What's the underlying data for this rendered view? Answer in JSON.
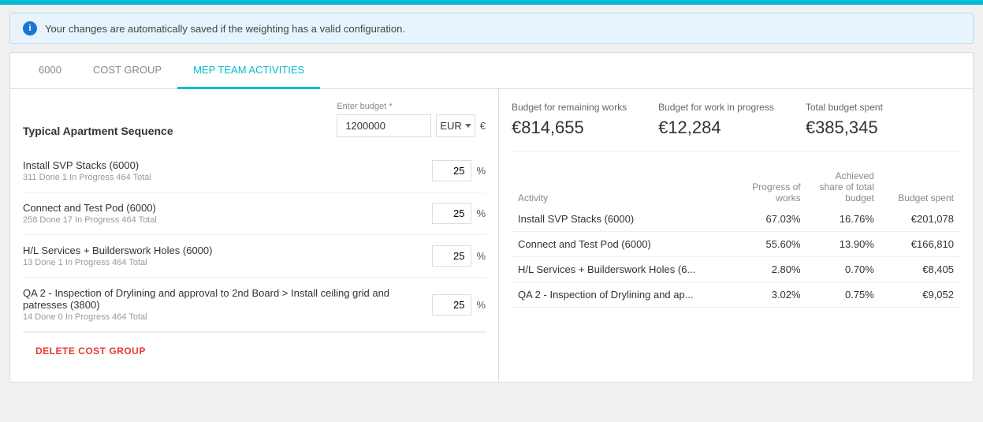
{
  "topBar": {},
  "infoBanner": {
    "text": "Your changes are automatically saved if the weighting has a valid configuration."
  },
  "tabs": [
    {
      "id": "tab-6000",
      "label": "6000",
      "active": false
    },
    {
      "id": "tab-cost-group",
      "label": "COST GROUP",
      "active": false
    },
    {
      "id": "tab-mep",
      "label": "MEP TEAM ACTIVITIES",
      "active": true
    }
  ],
  "leftPanel": {
    "sequenceTitle": "Typical Apartment Sequence",
    "budgetLabel": "Enter budget *",
    "budgetValue": "1200000",
    "currency": "EUR",
    "activities": [
      {
        "name": "Install SVP Stacks (6000)",
        "sub": "311 Done 1 In Progress 464 Total",
        "weight": "25"
      },
      {
        "name": "Connect and Test Pod (6000)",
        "sub": "258 Done 17 In Progress 464 Total",
        "weight": "25"
      },
      {
        "name": "H/L Services + Builderswork Holes (6000)",
        "sub": "13 Done 1 In Progress 464 Total",
        "weight": "25"
      },
      {
        "name": "QA 2 - Inspection of Drylining and approval to 2nd Board > Install ceiling grid and patresses (3800)",
        "sub": "14 Done 0 In Progress 464 Total",
        "weight": "25"
      }
    ],
    "deleteLabel": "DELETE COST GROUP"
  },
  "rightPanel": {
    "summaryItems": [
      {
        "label": "Budget for remaining works",
        "value": "€814,655"
      },
      {
        "label": "Budget for work in progress",
        "value": "€12,284"
      },
      {
        "label": "Total budget spent",
        "value": "€385,345"
      }
    ],
    "tableHeaders": {
      "activity": "Activity",
      "progressOfWorks": "Progress of works",
      "achievedShare": "Achieved share of total budget",
      "budgetSpent": "Budget spent"
    },
    "tableRows": [
      {
        "activity": "Install SVP Stacks (6000)",
        "progressOfWorks": "67.03%",
        "achievedShare": "16.76%",
        "budgetSpent": "€201,078"
      },
      {
        "activity": "Connect and Test Pod (6000)",
        "progressOfWorks": "55.60%",
        "achievedShare": "13.90%",
        "budgetSpent": "€166,810"
      },
      {
        "activity": "H/L Services + Builderswork Holes (6...",
        "progressOfWorks": "2.80%",
        "achievedShare": "0.70%",
        "budgetSpent": "€8,405"
      },
      {
        "activity": "QA 2 - Inspection of Drylining and ap...",
        "progressOfWorks": "3.02%",
        "achievedShare": "0.75%",
        "budgetSpent": "€9,052"
      }
    ]
  }
}
